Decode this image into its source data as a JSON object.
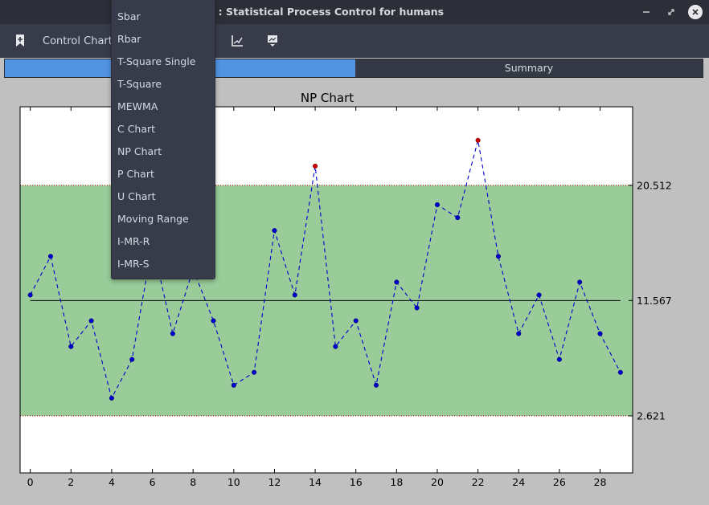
{
  "window": {
    "title": "SPC : Statistical Process Control for humans"
  },
  "toolbar": {
    "control_chart_label": "Control Chart:"
  },
  "tabs": [
    {
      "label": "",
      "active": true
    },
    {
      "label": "Summary",
      "active": false
    }
  ],
  "menu": {
    "items": [
      "Sbar",
      "Rbar",
      "T-Square Single",
      "T-Square",
      "MEWMA",
      "C Chart",
      "NP Chart",
      "P Chart",
      "U Chart",
      "Moving Range",
      "I-MR-R",
      "I-MR-S"
    ]
  },
  "colors": {
    "accent": "#5294e2",
    "in_control_band": "#99cc99",
    "series_line": "#0000cc",
    "out_of_control_point": "#cc0000",
    "center_line": "#000000",
    "limit_line": "#cc0000"
  },
  "chart_data": {
    "type": "line",
    "title": "NP Chart",
    "x": [
      0,
      1,
      2,
      3,
      4,
      5,
      6,
      7,
      8,
      9,
      10,
      11,
      12,
      13,
      14,
      15,
      16,
      17,
      18,
      19,
      20,
      21,
      22,
      23,
      24,
      25,
      26,
      27,
      28,
      29
    ],
    "y": [
      12,
      15,
      8,
      10,
      4,
      7,
      16,
      9,
      14,
      10,
      5,
      6,
      17,
      12,
      22,
      8,
      10,
      5,
      13,
      11,
      19,
      18,
      24,
      15,
      9,
      12,
      7,
      13,
      9,
      6
    ],
    "out_of_control_indices": [
      14,
      22
    ],
    "center_line": 11.567,
    "ucl": 20.512,
    "lcl": 2.621,
    "right_axis_labels": [
      "20.512",
      "11.567",
      "2.621"
    ],
    "xticks": [
      0,
      2,
      4,
      6,
      8,
      10,
      12,
      14,
      16,
      18,
      20,
      22,
      24,
      26,
      28
    ],
    "xlim": [
      -0.5,
      29.6
    ],
    "ylim": [
      -1.8,
      26.6
    ],
    "grid": false,
    "legend": "none"
  }
}
